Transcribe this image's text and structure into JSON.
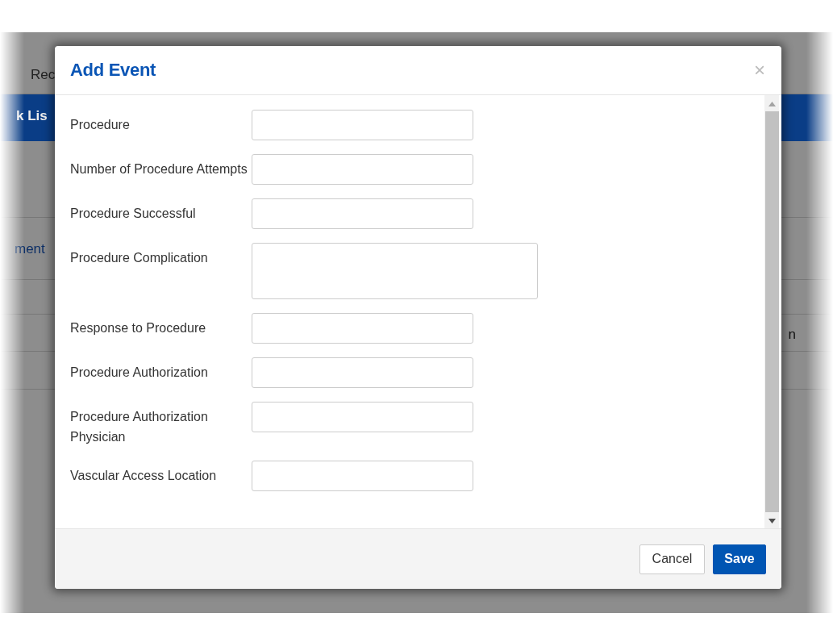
{
  "background_page": {
    "top_link": "Rec",
    "banner_text": "k Lis",
    "row_link": "ment",
    "row_text": "n"
  },
  "dialog": {
    "title": "Add Event",
    "close": "×",
    "fields": [
      {
        "label": "Procedure",
        "kind": "input"
      },
      {
        "label": "Number of Procedure Attempts",
        "kind": "input"
      },
      {
        "label": "Procedure Successful",
        "kind": "input"
      },
      {
        "label": "Procedure Complication",
        "kind": "textarea"
      },
      {
        "label": "Response to Procedure",
        "kind": "input"
      },
      {
        "label": "Procedure Authorization",
        "kind": "input"
      },
      {
        "label": "Procedure Authorization Physician",
        "kind": "input"
      },
      {
        "label": "Vascular Access Location",
        "kind": "input"
      }
    ],
    "buttons": [
      {
        "label": "Cancel",
        "kind": "secondary"
      },
      {
        "label": "Save",
        "kind": "primary"
      }
    ]
  }
}
